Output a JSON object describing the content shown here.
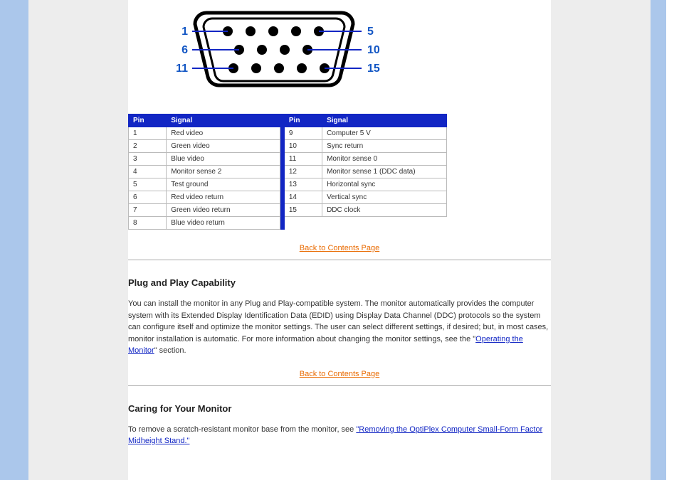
{
  "connector": {
    "labels": {
      "l1": "1",
      "l2": "6",
      "l3": "11",
      "r1": "5",
      "r2": "10",
      "r3": "15"
    }
  },
  "pin_table": {
    "headers": {
      "pin": "Pin",
      "signal": "Signal",
      "pin2": "Pin",
      "signal2": "Signal"
    },
    "rows_left": [
      {
        "pin": "1",
        "signal": "Red video"
      },
      {
        "pin": "2",
        "signal": "Green video"
      },
      {
        "pin": "3",
        "signal": "Blue video"
      },
      {
        "pin": "4",
        "signal": "Monitor sense 2"
      },
      {
        "pin": "5",
        "signal": "Test ground"
      },
      {
        "pin": "6",
        "signal": "Red video return"
      },
      {
        "pin": "7",
        "signal": "Green video return"
      },
      {
        "pin": "8",
        "signal": "Blue video return"
      }
    ],
    "rows_right": [
      {
        "pin": "9",
        "signal": "Computer 5 V"
      },
      {
        "pin": "10",
        "signal": "Sync return"
      },
      {
        "pin": "11",
        "signal": "Monitor sense 0"
      },
      {
        "pin": "12",
        "signal": "Monitor sense 1 (DDC data)"
      },
      {
        "pin": "13",
        "signal": "Horizontal sync"
      },
      {
        "pin": "14",
        "signal": "Vertical sync"
      },
      {
        "pin": "15",
        "signal": "DDC clock"
      }
    ]
  },
  "back_link_label": "Back to Contents Page",
  "section1": {
    "title": "Plug and Play Capability",
    "body_prefix": "You can install the monitor in any Plug and Play-compatible system. The monitor automatically provides the computer system with its Extended Display Identification Data (EDID) using Display Data Channel (DDC) protocols so the system can configure itself and optimize the monitor settings. The user can select different settings, if desired; but, in most cases, monitor installation is automatic. For more information about changing the monitor settings, see the \"",
    "body_link": "Operating the Monitor",
    "body_suffix": "\" section."
  },
  "section2": {
    "title": "Caring for Your Monitor",
    "remove": "To remove a scratch-resistant monitor base from the monitor, see ",
    "remove_link": "\"Removing the OptiPlex Computer Small-Form Factor Midheight Stand.\""
  }
}
